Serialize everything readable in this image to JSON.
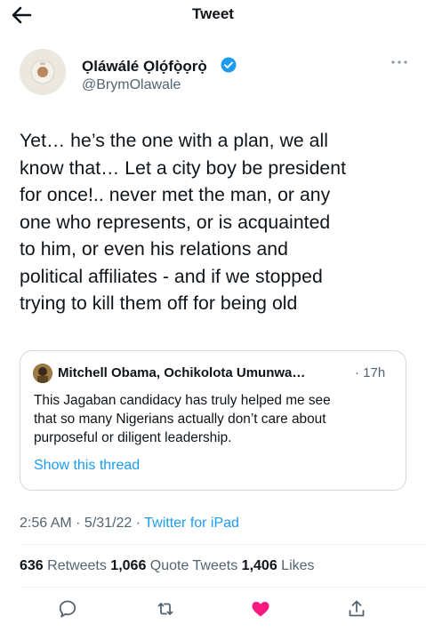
{
  "header": {
    "title": "Tweet",
    "back_icon": "back-arrow-icon"
  },
  "author": {
    "name": "Ọláwálé  Ọlọ́fọ̀ọrọ̀",
    "handle": "@BrymOlawale",
    "verified": true
  },
  "tweet": {
    "text": "Yet… he’s the one with a plan, we all\nknow that… Let a city boy be president\nfor once!.. never met the man, or any\none who represents, or is acquainted\nto him, or even his relations and\npolitical affiliates - and if we stopped\ntrying to kill them off for being old"
  },
  "quote": {
    "author_name": "Mitchell Obama, Ochikolota Umunwa…",
    "time": "· 17h",
    "text": "This Jagaban candidacy has truly helped me see\nthat so many Nigerians actually don’t care about\npurposeful or diligent leadership.",
    "link": "Show this thread"
  },
  "meta": {
    "time": "2:56 AM",
    "sep1": " · ",
    "date": "5/31/22",
    "sep2": " · ",
    "source": "Twitter for iPad"
  },
  "stats": {
    "retweets_count": "636",
    "retweets_label": " Retweets  ",
    "quotes_count": "1,066",
    "quotes_label": " Quote Tweets  ",
    "likes_count": "1,406",
    "likes_label": " Likes"
  },
  "actions": [
    "reply-icon",
    "retweet-icon",
    "like-icon",
    "share-icon"
  ],
  "colors": {
    "accent": "#1d9bf0",
    "like": "#f91880",
    "text": "#0f1419",
    "muted": "#536471",
    "border": "#cfd9de"
  }
}
